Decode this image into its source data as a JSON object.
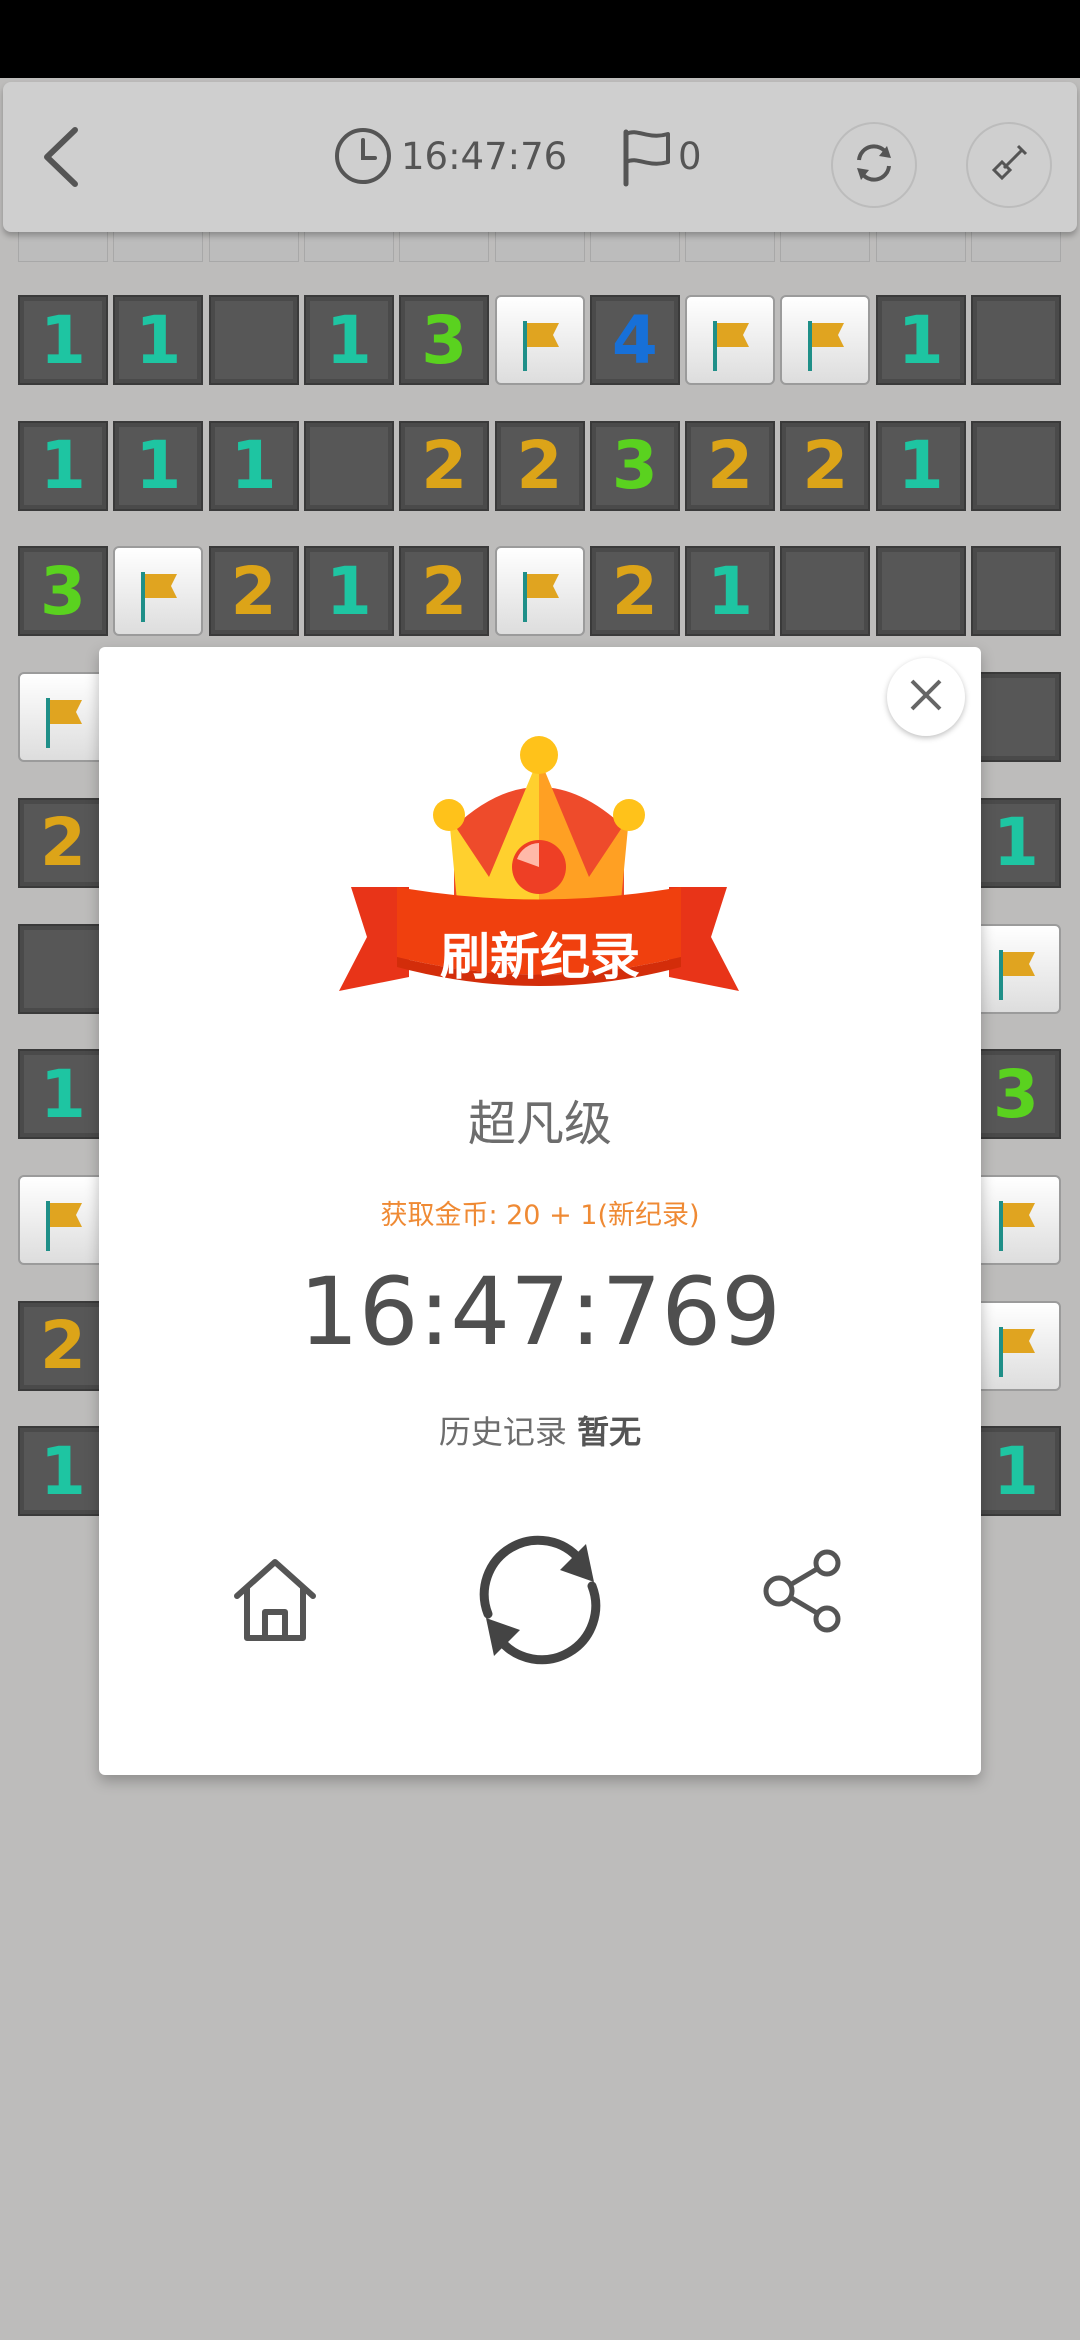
{
  "topbar": {
    "timer": "16:47:76",
    "flags": "0",
    "icons": [
      "back-arrow-icon",
      "clock-icon",
      "flag-icon",
      "refresh-icon",
      "shovel-icon"
    ]
  },
  "board": {
    "colors": {
      "1": "#1ec5a2",
      "2": "#dca418",
      "3": "#5ad21f",
      "4": "#1770d8",
      "flag": "#e0a420"
    },
    "rows": [
      [
        "1",
        "1",
        "",
        "1",
        "3",
        "F",
        "4",
        "F",
        "F",
        "1",
        ""
      ],
      [
        "1",
        "1",
        "1",
        "",
        "2",
        "2",
        "3",
        "2",
        "2",
        "1",
        ""
      ],
      [
        "3",
        "F",
        "2",
        "1",
        "2",
        "F",
        "2",
        "1",
        "",
        "",
        ""
      ],
      [
        "F",
        "",
        "",
        "",
        "",
        "",
        "",
        "",
        "",
        "",
        ""
      ],
      [
        "2",
        "",
        "",
        "",
        "",
        "",
        "",
        "",
        "",
        "",
        "1"
      ],
      [
        "",
        "",
        "",
        "",
        "",
        "",
        "",
        "",
        "",
        "",
        "F"
      ],
      [
        "1",
        "",
        "",
        "",
        "",
        "",
        "",
        "",
        "",
        "",
        "3"
      ],
      [
        "F",
        "",
        "",
        "",
        "",
        "",
        "",
        "",
        "",
        "",
        "F"
      ],
      [
        "2",
        "",
        "",
        "",
        "",
        "",
        "",
        "",
        "",
        "",
        "F"
      ],
      [
        "1",
        "",
        "",
        "",
        "",
        "",
        "",
        "",
        "",
        "",
        "1"
      ]
    ]
  },
  "dialog": {
    "banner": "刷新纪录",
    "level": "超凡级",
    "coins": "获取金币: 20 + 1(新纪录)",
    "final_time": "16:47:769",
    "history_label": "历史记录",
    "history_value": "暂无",
    "actions": [
      "home-icon",
      "replay-icon",
      "share-icon"
    ]
  }
}
